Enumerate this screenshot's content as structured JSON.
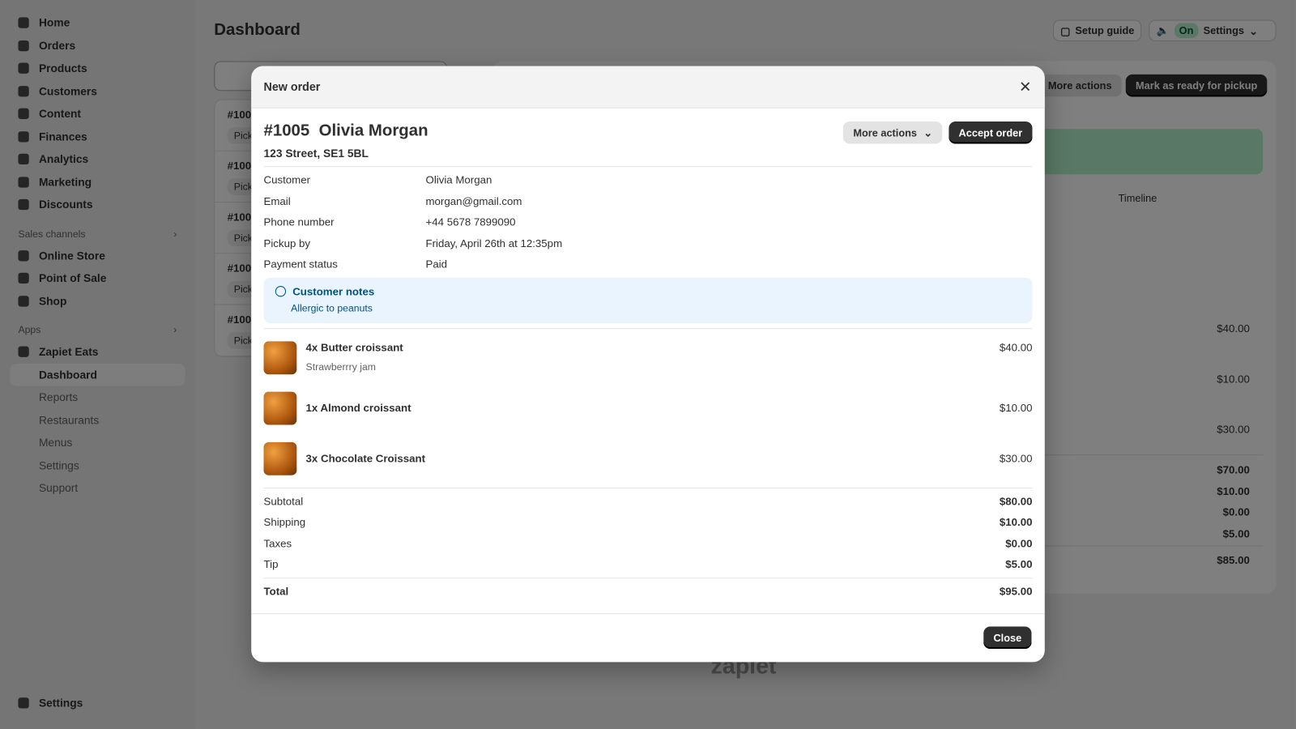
{
  "sidebar": {
    "items": [
      "Home",
      "Orders",
      "Products",
      "Customers",
      "Content",
      "Finances",
      "Analytics",
      "Marketing",
      "Discounts"
    ],
    "sales_channels_label": "Sales channels",
    "sales_channels": [
      "Online Store",
      "Point of Sale",
      "Shop"
    ],
    "apps_label": "Apps",
    "app": "Zapiet Eats",
    "app_items": [
      "Dashboard",
      "Reports",
      "Restaurants",
      "Menus",
      "Settings",
      "Support"
    ],
    "settings": "Settings"
  },
  "header": {
    "title": "Dashboard",
    "setup_guide": "Setup guide",
    "sound_status": "On",
    "settings": "Settings"
  },
  "background": {
    "orders": [
      "#100",
      "#100",
      "#100",
      "#100",
      "#100"
    ],
    "pill": "Pick",
    "more_actions": "More actions",
    "mark_ready": "Mark as ready for pickup",
    "timeline": "Timeline",
    "prices": [
      "$40.00",
      "$10.00",
      "$30.00"
    ],
    "totals": [
      "$70.00",
      "$10.00",
      "$0.00",
      "$5.00",
      "$85.00"
    ],
    "brand": "zapiet"
  },
  "modal": {
    "title": "New order",
    "order_number": "#1005",
    "customer_name": "Olivia Morgan",
    "address": "123 Street, SE1 5BL",
    "more_actions": "More actions",
    "accept": "Accept order",
    "fields": [
      {
        "k": "Customer",
        "v": "Olivia Morgan"
      },
      {
        "k": "Email",
        "v": "morgan@gmail.com"
      },
      {
        "k": "Phone number",
        "v": "+44 5678 7899090"
      },
      {
        "k": "Pickup by",
        "v": "Friday, April 26th at 12:35pm"
      },
      {
        "k": "Payment status",
        "v": "Paid"
      }
    ],
    "notes_title": "Customer notes",
    "notes": "Allergic to peanuts",
    "items": [
      {
        "name": "4x Butter croissant",
        "option": "Strawberrry jam",
        "price": "$40.00"
      },
      {
        "name": "1x Almond croissant",
        "price": "$10.00"
      },
      {
        "name": "3x  Chocolate Croissant",
        "price": "$30.00"
      }
    ],
    "totals": [
      {
        "k": "Subtotal",
        "v": "$80.00"
      },
      {
        "k": "Shipping",
        "v": "$10.00"
      },
      {
        "k": "Taxes",
        "v": "$0.00"
      },
      {
        "k": "Tip",
        "v": "$5.00"
      }
    ],
    "total_label": "Total",
    "total": "$95.00",
    "close": "Close"
  },
  "colors": {
    "accent": "#303030",
    "notes_bg": "#eaf4ff",
    "notes_text": "#00527c",
    "status_on": "#b4f0cc"
  }
}
